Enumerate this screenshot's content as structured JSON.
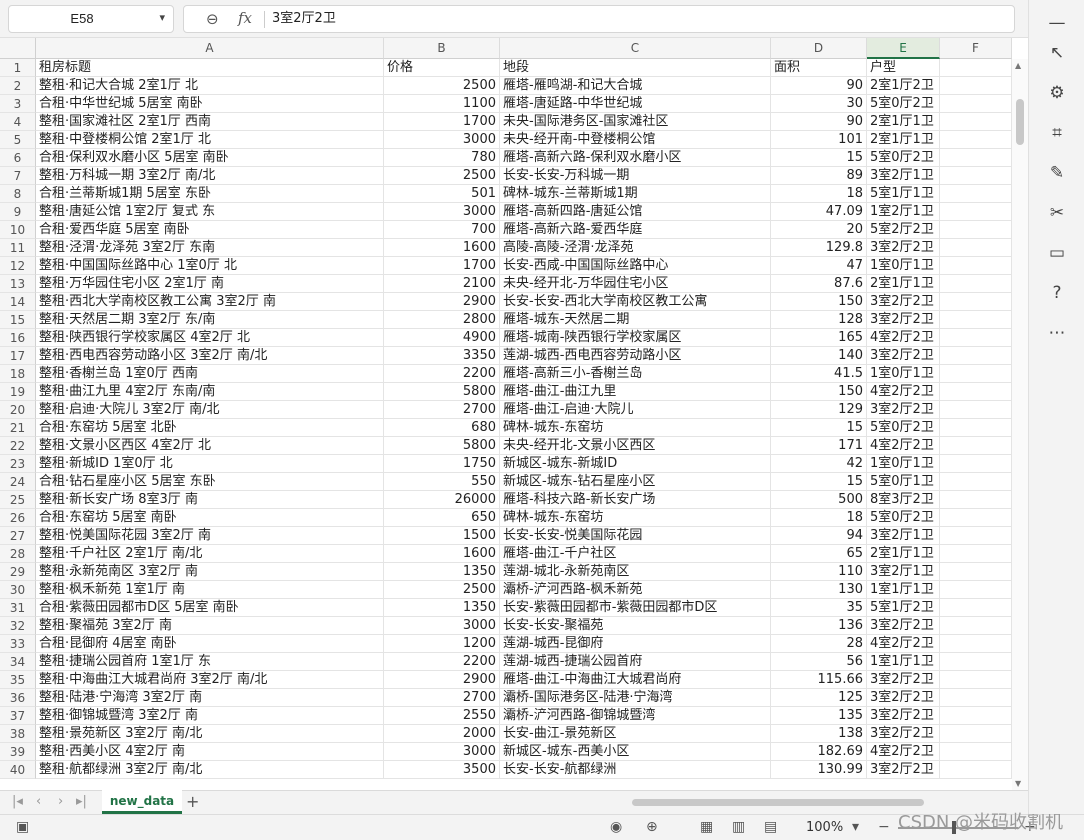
{
  "formula_bar": {
    "cell_ref": "E58",
    "content": "3室2厅2卫"
  },
  "columns": [
    "A",
    "B",
    "C",
    "D",
    "E",
    "F"
  ],
  "rows": [
    [
      "1",
      "租房标题",
      "价格",
      "地段",
      "面积",
      "户型"
    ],
    [
      "2",
      "整租·和记大合城 2室1厅 北",
      "2500",
      "雁塔-雁鸣湖-和记大合城",
      "90",
      "2室1厅2卫"
    ],
    [
      "3",
      "合租·中华世纪城 5居室 南卧",
      "1100",
      "雁塔-唐延路-中华世纪城",
      "30",
      "5室0厅2卫"
    ],
    [
      "4",
      "整租·国家滩社区 2室1厅 西南",
      "1700",
      "未央-国际港务区-国家滩社区",
      "90",
      "2室1厅1卫"
    ],
    [
      "5",
      "整租·中登楼桐公馆 2室1厅 北",
      "3000",
      "未央-经开南-中登楼桐公馆",
      "101",
      "2室1厅1卫"
    ],
    [
      "6",
      "合租·保利双水磨小区 5居室 南卧",
      "780",
      "雁塔-高新六路-保利双水磨小区",
      "15",
      "5室0厅2卫"
    ],
    [
      "7",
      "整租·万科城一期 3室2厅 南/北",
      "2500",
      "长安-长安-万科城一期",
      "89",
      "3室2厅1卫"
    ],
    [
      "8",
      "合租·兰蒂斯城1期 5居室 东卧",
      "501",
      "碑林-城东-兰蒂斯城1期",
      "18",
      "5室1厅1卫"
    ],
    [
      "9",
      "整租·唐延公馆 1室2厅 复式 东",
      "3000",
      "雁塔-高新四路-唐延公馆",
      "47.09",
      "1室2厅1卫"
    ],
    [
      "10",
      "合租·爱西华庭 5居室 南卧",
      "700",
      "雁塔-高新六路-爱西华庭",
      "20",
      "5室2厅2卫"
    ],
    [
      "11",
      "整租·泾渭·龙泽苑 3室2厅 东南",
      "1600",
      "高陵-高陵-泾渭·龙泽苑",
      "129.8",
      "3室2厅2卫"
    ],
    [
      "12",
      "整租·中国国际丝路中心 1室0厅 北",
      "1700",
      "长安-西咸-中国国际丝路中心",
      "47",
      "1室0厅1卫"
    ],
    [
      "13",
      "整租·万华园住宅小区 2室1厅 南",
      "2100",
      "未央-经开北-万华园住宅小区",
      "87.6",
      "2室1厅1卫"
    ],
    [
      "14",
      "整租·西北大学南校区教工公寓 3室2厅 南",
      "2900",
      "长安-长安-西北大学南校区教工公寓",
      "150",
      "3室2厅2卫"
    ],
    [
      "15",
      "整租·天然居二期 3室2厅 东/南",
      "2800",
      "雁塔-城东-天然居二期",
      "128",
      "3室2厅2卫"
    ],
    [
      "16",
      "整租·陕西银行学校家属区 4室2厅 北",
      "4900",
      "雁塔-城南-陕西银行学校家属区",
      "165",
      "4室2厅2卫"
    ],
    [
      "17",
      "整租·西电西容劳动路小区 3室2厅 南/北",
      "3350",
      "莲湖-城西-西电西容劳动路小区",
      "140",
      "3室2厅2卫"
    ],
    [
      "18",
      "整租·香榭兰岛 1室0厅 西南",
      "2200",
      "雁塔-高新三小-香榭兰岛",
      "41.5",
      "1室0厅1卫"
    ],
    [
      "19",
      "整租·曲江九里 4室2厅 东南/南",
      "5800",
      "雁塔-曲江-曲江九里",
      "150",
      "4室2厅2卫"
    ],
    [
      "20",
      "整租·启迪·大院儿 3室2厅 南/北",
      "2700",
      "雁塔-曲江-启迪·大院儿",
      "129",
      "3室2厅2卫"
    ],
    [
      "21",
      "合租·东窑坊 5居室 北卧",
      "680",
      "碑林-城东-东窑坊",
      "15",
      "5室0厅2卫"
    ],
    [
      "22",
      "整租·文景小区西区 4室2厅 北",
      "5800",
      "未央-经开北-文景小区西区",
      "171",
      "4室2厅2卫"
    ],
    [
      "23",
      "整租·新城ID 1室0厅 北",
      "1750",
      "新城区-城东-新城ID",
      "42",
      "1室0厅1卫"
    ],
    [
      "24",
      "合租·钻石星座小区 5居室 东卧",
      "550",
      "新城区-城东-钻石星座小区",
      "15",
      "5室0厅1卫"
    ],
    [
      "25",
      "整租·新长安广场 8室3厅 南",
      "26000",
      "雁塔-科技六路-新长安广场",
      "500",
      "8室3厅2卫"
    ],
    [
      "26",
      "合租·东窑坊 5居室 南卧",
      "650",
      "碑林-城东-东窑坊",
      "18",
      "5室0厅2卫"
    ],
    [
      "27",
      "整租·悦美国际花园 3室2厅 南",
      "1500",
      "长安-长安-悦美国际花园",
      "94",
      "3室2厅1卫"
    ],
    [
      "28",
      "整租·千户社区 2室1厅 南/北",
      "1600",
      "雁塔-曲江-千户社区",
      "65",
      "2室1厅1卫"
    ],
    [
      "29",
      "整租·永新苑南区 3室2厅 南",
      "1350",
      "莲湖-城北-永新苑南区",
      "110",
      "3室2厅1卫"
    ],
    [
      "30",
      "整租·枫禾新苑 1室1厅 南",
      "2500",
      "灞桥-浐河西路-枫禾新苑",
      "130",
      "1室1厅1卫"
    ],
    [
      "31",
      "合租·紫薇田园都市D区 5居室 南卧",
      "1350",
      "长安-紫薇田园都市-紫薇田园都市D区",
      "35",
      "5室1厅2卫"
    ],
    [
      "32",
      "整租·聚福苑 3室2厅 南",
      "3000",
      "长安-长安-聚福苑",
      "136",
      "3室2厅2卫"
    ],
    [
      "33",
      "合租·昆御府 4居室 南卧",
      "1200",
      "莲湖-城西-昆御府",
      "28",
      "4室2厅2卫"
    ],
    [
      "34",
      "整租·捷瑞公园首府 1室1厅 东",
      "2200",
      "莲湖-城西-捷瑞公园首府",
      "56",
      "1室1厅1卫"
    ],
    [
      "35",
      "整租·中海曲江大城君尚府 3室2厅 南/北",
      "2900",
      "雁塔-曲江-中海曲江大城君尚府",
      "115.66",
      "3室2厅2卫"
    ],
    [
      "36",
      "整租·陆港·宁海湾 3室2厅 南",
      "2700",
      "灞桥-国际港务区-陆港·宁海湾",
      "125",
      "3室2厅2卫"
    ],
    [
      "37",
      "整租·御锦城暨湾 3室2厅 南",
      "2550",
      "灞桥-浐河西路-御锦城暨湾",
      "135",
      "3室2厅2卫"
    ],
    [
      "38",
      "整租·景苑新区 3室2厅 南/北",
      "2000",
      "长安-曲江-景苑新区",
      "138",
      "3室2厅2卫"
    ],
    [
      "39",
      "整租·西美小区 4室2厅 南",
      "3000",
      "新城区-城东-西美小区",
      "182.69",
      "4室2厅2卫"
    ],
    [
      "40",
      "整租·航都绿洲 3室2厅 南/北",
      "3500",
      "长安-长安-航都绿洲",
      "130.99",
      "3室2厅2卫"
    ]
  ],
  "sheet_tab": "new_data",
  "zoom": "100%",
  "watermark": "CSDN @米码收割机"
}
